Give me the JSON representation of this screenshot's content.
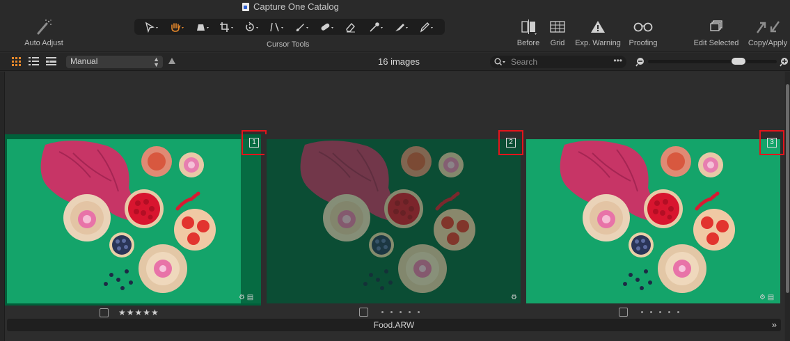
{
  "window": {
    "title": "Capture One Catalog"
  },
  "toolbar": {
    "auto_adjust": "Auto Adjust",
    "cursor_tools_label": "Cursor Tools",
    "before": "Before",
    "grid": "Grid",
    "exp_warning": "Exp. Warning",
    "proofing": "Proofing",
    "edit_selected": "Edit Selected",
    "copy_apply": "Copy/Apply",
    "cursor_tools": [
      "select-icon",
      "pan-hand-icon",
      "keystone-icon",
      "crop-icon",
      "rotate-icon",
      "straighten-icon",
      "brush-icon",
      "heal-icon",
      "eraser-icon",
      "color-picker-icon",
      "gradient-icon",
      "annotate-icon"
    ],
    "active_tool": "pan-hand-icon",
    "accent_color": "#e8892b"
  },
  "filterbar": {
    "sort_value": "Manual",
    "image_count": "16 images",
    "search_placeholder": "Search",
    "more_glyph": "•••",
    "zoom_level": 0.73
  },
  "images": [
    {
      "number": "1",
      "rating": 5,
      "rating_glyphs": "★★★★★",
      "variant": "normal"
    },
    {
      "number": "2",
      "rating": 0,
      "rating_glyphs": "",
      "variant": "dark"
    },
    {
      "number": "3",
      "rating": 0,
      "rating_glyphs": "",
      "variant": "normal"
    }
  ],
  "filename": "Food.ARW",
  "expand_glyph": "»",
  "highlight_color": "#e5141b"
}
